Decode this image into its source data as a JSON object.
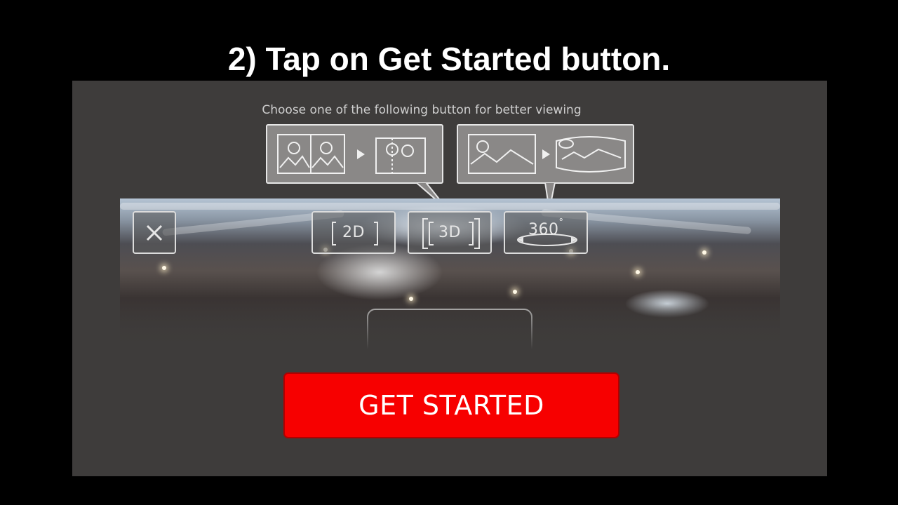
{
  "slide": {
    "title": "2) Tap on Get Started button."
  },
  "screen": {
    "instruction": "Choose one of the following button for better viewing",
    "tips": [
      {
        "icon": "2d-to-3d-illustration-icon"
      },
      {
        "icon": "flat-to-360-illustration-icon"
      }
    ],
    "close_icon": "close-icon",
    "modes": [
      {
        "label": "2D"
      },
      {
        "label": "3D"
      },
      {
        "label": "360"
      }
    ],
    "degree_symbol": "°",
    "get_started_label": "GET STARTED"
  },
  "colors": {
    "background": "#000000",
    "screen": "#3e3c3b",
    "accent_button": "#f70000",
    "tip_bubble": "#8a8887"
  }
}
